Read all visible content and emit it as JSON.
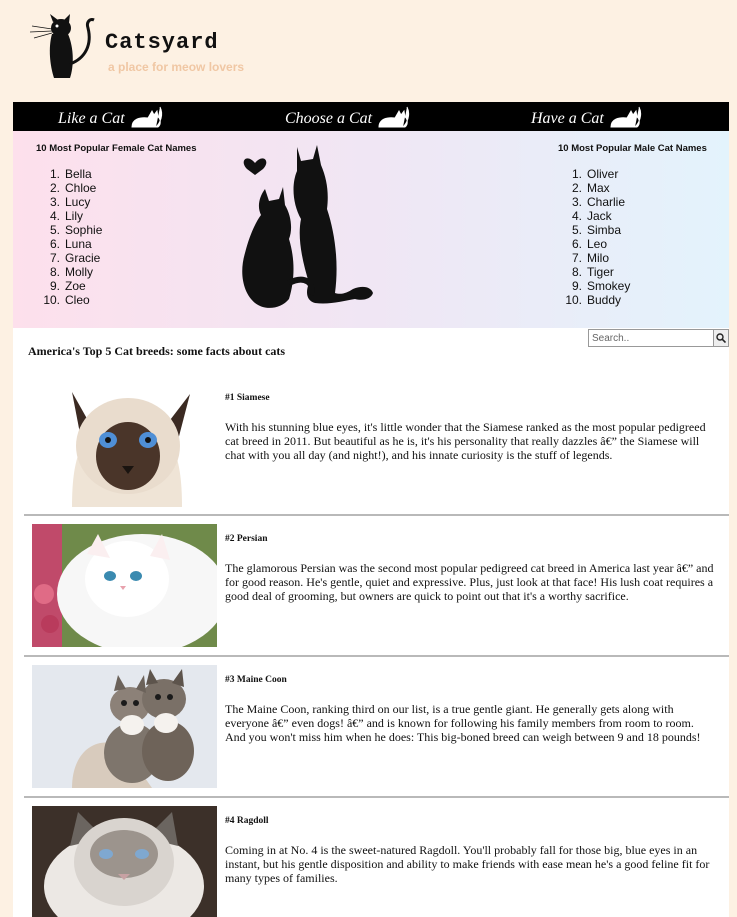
{
  "header": {
    "site_title": "Catsyard",
    "tagline": "a place for meow lovers"
  },
  "nav": {
    "items": [
      {
        "label": "Like a Cat"
      },
      {
        "label": "Choose a Cat"
      },
      {
        "label": "Have a Cat"
      }
    ]
  },
  "hero": {
    "female": {
      "title": "10 Most Popular Female Cat Names",
      "names": [
        "Bella",
        "Chloe",
        "Lucy",
        "Lily",
        "Sophie",
        "Luna",
        "Gracie",
        "Molly",
        "Zoe",
        "Cleo"
      ]
    },
    "male": {
      "title": "10 Most Popular Male Cat Names",
      "names": [
        "Oliver",
        "Max",
        "Charlie",
        "Jack",
        "Simba",
        "Leo",
        "Milo",
        "Tiger",
        "Smokey",
        "Buddy"
      ]
    }
  },
  "section": {
    "heading": "America's Top 5 Cat breeds: some facts about cats"
  },
  "search": {
    "placeholder": "Search.."
  },
  "breeds": [
    {
      "title": "#1 Siamese",
      "text": "With his stunning blue eyes, it's little wonder that the Siamese ranked as the most popular pedigreed cat breed in 2011. But beautiful as he is, it's his personality that really dazzles â€” the Siamese will chat with you all day (and night!), and his innate curiosity is the stuff of legends."
    },
    {
      "title": "#2 Persian",
      "text": "The glamorous Persian was the second most popular pedigreed cat breed in America last year â€” and for good reason. He's gentle, quiet and expressive. Plus, just look at that face! His lush coat requires a good deal of grooming, but owners are quick to point out that it's a worthy sacrifice."
    },
    {
      "title": "#3 Maine Coon",
      "text": "The Maine Coon, ranking third on our list, is a true gentle giant. He generally gets along with everyone â€” even dogs! â€” and is known for following his family members from room to room. And you won't miss him when he does: This big-boned breed can weigh between 9 and 18 pounds!"
    },
    {
      "title": "#4 Ragdoll",
      "text": "Coming in at No. 4 is the sweet-natured Ragdoll. You'll probably fall for those big, blue eyes in an instant, but his gentle disposition and ability to make friends with ease mean he's a good feline fit for many types of families."
    }
  ]
}
